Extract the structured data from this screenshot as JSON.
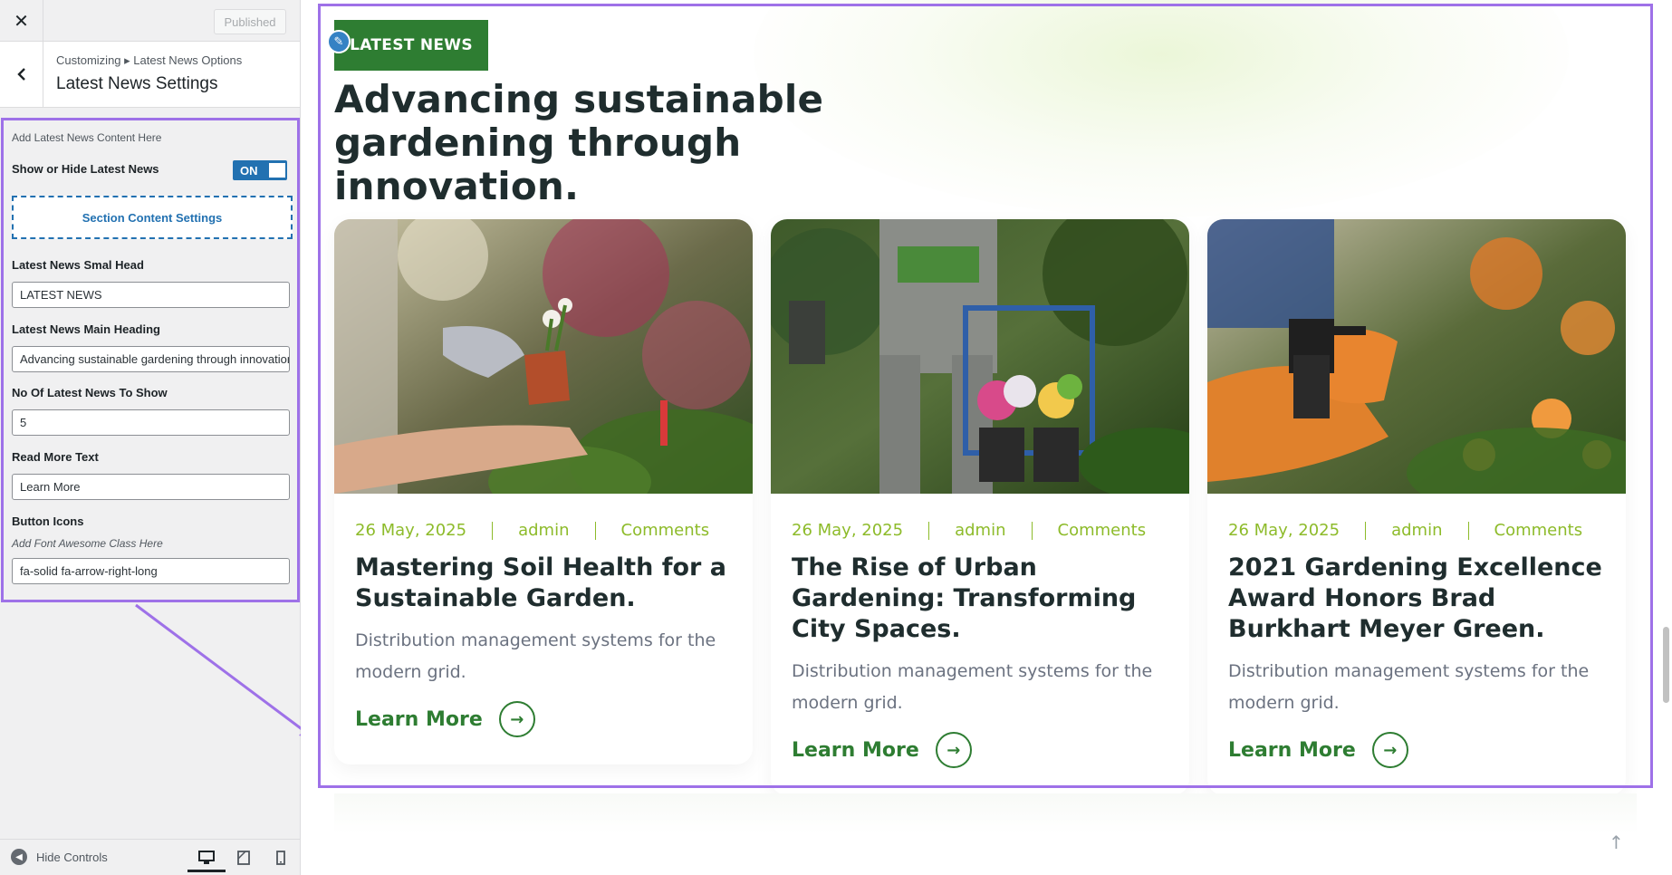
{
  "customizer": {
    "close_icon": "close-icon",
    "published_label": "Published",
    "breadcrumb": "Customizing ▸ Latest News Options",
    "section_title": "Latest News Settings",
    "note": "Add Latest News Content Here",
    "show_hide_label": "Show or Hide Latest News",
    "toggle_state": "ON",
    "section_content_button": "Section Content Settings",
    "fields": {
      "small_head": {
        "label": "Latest News Smal Head",
        "value": "LATEST NEWS"
      },
      "main_heading": {
        "label": "Latest News Main Heading",
        "value": "Advancing sustainable gardening through innovation."
      },
      "count": {
        "label": "No Of Latest News To Show",
        "value": "5"
      },
      "read_more": {
        "label": "Read More Text",
        "value": "Learn More"
      },
      "button_icons": {
        "label": "Button Icons",
        "hint": "Add Font Awesome Class Here",
        "value": "fa-solid fa-arrow-right-long"
      }
    },
    "footer": {
      "hide_controls": "Hide Controls"
    },
    "accent_color": "#9e71e8",
    "wp_blue": "#2271b1"
  },
  "preview": {
    "badge": "LATEST NEWS",
    "heading": "Advancing sustainable gardening through innovation.",
    "brand_green": "#2e7d32",
    "meta_color": "#8dbb2a",
    "posts": [
      {
        "date": "26 May, 2025",
        "author": "admin",
        "comments": "Comments",
        "title": "Mastering Soil Health for a Sustainable Garden.",
        "excerpt": "Distribution management systems for the modern grid.",
        "read_more": "Learn More"
      },
      {
        "date": "26 May, 2025",
        "author": "admin",
        "comments": "Comments",
        "title": "The Rise of Urban Gardening: Transforming City Spaces.",
        "excerpt": "Distribution management systems for the modern grid.",
        "read_more": "Learn More"
      },
      {
        "date": "26 May, 2025",
        "author": "admin",
        "comments": "Comments",
        "title": "2021 Gardening Excellence Award Honors Brad Burkhart Meyer Green.",
        "excerpt": "Distribution management systems for the modern grid.",
        "read_more": "Learn More"
      }
    ]
  }
}
